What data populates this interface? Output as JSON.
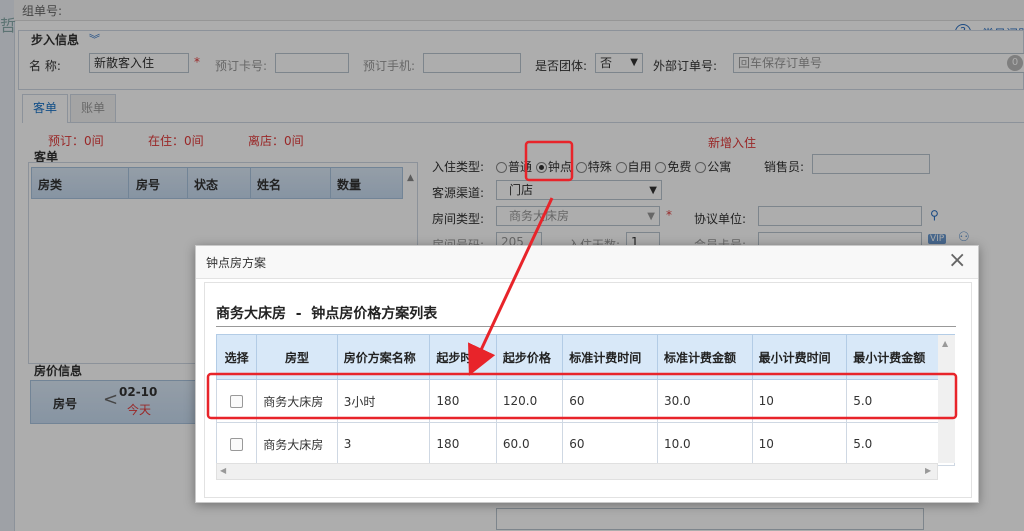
{
  "top": {
    "group_no_label": "组单号:",
    "left_char": "哲"
  },
  "help": {
    "icon_glyph": "?",
    "label": "常见问题"
  },
  "checkin": {
    "section_title": "步入信息",
    "name_label": "名    称:",
    "name_value": "新散客入住",
    "required_mark": "*",
    "booking_card_label": "预订卡号:",
    "booking_phone_label": "预订手机:",
    "is_group_label": "是否团体:",
    "is_group_value": "否",
    "ext_order_label": "外部订单号:",
    "ext_order_placeholder": "回车保存订单号",
    "badge_value": "0"
  },
  "tabs": [
    {
      "label": "客单"
    },
    {
      "label": "账单"
    }
  ],
  "stats": {
    "booked": "预订：0间",
    "staying": "在住：0间",
    "leaving": "离店：0间",
    "new_checkin": "新增入住"
  },
  "guest_panel": {
    "title": "客单",
    "columns": [
      "房类",
      "房号",
      "状态",
      "姓名",
      "数量"
    ]
  },
  "price_panel": {
    "title": "房价信息",
    "room_no_label": "房号",
    "date": "02-10",
    "today": "今天"
  },
  "form": {
    "checkin_type_label": "入住类型:",
    "types": [
      "普通",
      "钟点",
      "特殊",
      "自用",
      "免费",
      "公寓"
    ],
    "selected_type": "钟点",
    "salesperson_label": "销售员:",
    "source_label": "客源渠道:",
    "source_value": "门店",
    "room_type_label": "房间类型:",
    "room_type_value": "商务大床房",
    "agreement_label": "协议单位:",
    "room_no_label": "房间号码:",
    "room_no_value": "205",
    "days_label": "入住天数:",
    "days_value": "1",
    "member_card_label": "会员卡号:",
    "vip_label": "VIP"
  },
  "dialog": {
    "title": "钟点房方案",
    "subtitle": "商务大床房  -  钟点房价格方案列表",
    "columns": [
      "选择",
      "房型",
      "房价方案名称",
      "起步时间",
      "起步价格",
      "标准计费时间",
      "标准计费金额",
      "最小计费时间",
      "最小计费金额"
    ],
    "rows": [
      [
        "",
        "商务大床房",
        "3小时",
        "180",
        "120.0",
        "60",
        "30.0",
        "10",
        "5.0"
      ],
      [
        "",
        "商务大床房",
        "3",
        "180",
        "60.0",
        "60",
        "10.0",
        "10",
        "5.0"
      ]
    ]
  },
  "colors": {
    "annotation": "#e8242a",
    "header_blue": "#d8e8f8",
    "link_blue": "#1a73c8"
  }
}
